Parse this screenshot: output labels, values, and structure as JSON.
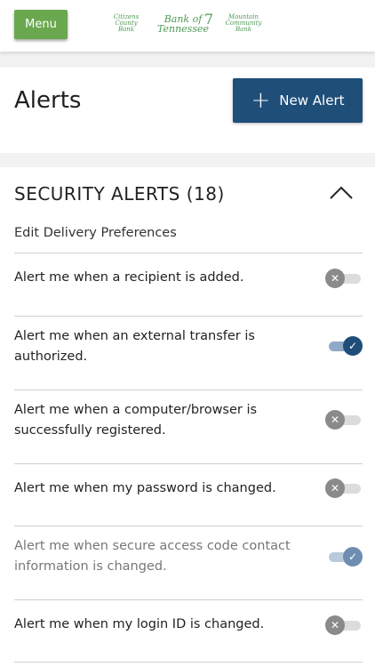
{
  "header": {
    "menu_label": "Menu",
    "logos": {
      "logo1": "Citizens County Bank",
      "logo2": "Bank of Tennessee",
      "logo2_mark": "7",
      "logo3": "Mountain Community Bank"
    }
  },
  "page": {
    "title": "Alerts",
    "new_alert_label": "New Alert"
  },
  "section": {
    "title": "SECURITY ALERTS (18)",
    "edit_preferences": "Edit Delivery Preferences",
    "alerts": [
      {
        "text": "Alert me when a recipient is added.",
        "enabled": false
      },
      {
        "text": "Alert me when an external transfer is authorized.",
        "enabled": true
      },
      {
        "text": "Alert me when a computer/browser is successfully registered.",
        "enabled": false
      },
      {
        "text": "Alert me when my password is changed.",
        "enabled": false
      },
      {
        "text": "Alert me when secure access code contact information is changed.",
        "enabled": true
      },
      {
        "text": "Alert me when my login ID is changed.",
        "enabled": false
      }
    ]
  },
  "colors": {
    "menu_green": "#6aa84f",
    "primary_navy": "#1f4e79",
    "logo_green": "#4d9a57"
  }
}
